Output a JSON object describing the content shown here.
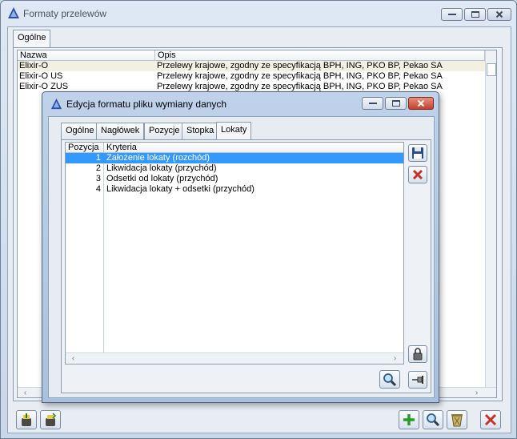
{
  "window": {
    "title": "Formaty przelewów",
    "tab": "Ogólne",
    "columns": [
      "Nazwa",
      "Opis"
    ],
    "rows": [
      {
        "name": "Elixir-O",
        "desc": "Przelewy krajowe, zgodny ze specyfikacją BPH, ING, PKO BP, Pekao SA"
      },
      {
        "name": "Elixir-O US",
        "desc": "Przelewy krajowe, zgodny ze specyfikacją BPH, ING, PKO BP, Pekao SA"
      },
      {
        "name": "Elixir-O ZUS",
        "desc": "Przelewy krajowe, zgodny ze specyfikacją BPH, ING, PKO BP, Pekao SA"
      }
    ]
  },
  "dialog": {
    "title": "Edycja formatu pliku wymiany danych",
    "tabs": [
      "Ogólne",
      "Nagłówek",
      "Pozycje",
      "Stopka",
      "Lokaty"
    ],
    "active_tab": "Lokaty",
    "columns": [
      "Pozycja",
      "Kryteria"
    ],
    "rows": [
      {
        "pos": "1",
        "crit": "Założenie lokaty (rozchód)"
      },
      {
        "pos": "2",
        "crit": "Likwidacja lokaty (przychód)"
      },
      {
        "pos": "3",
        "crit": "Odsetki od lokaty (przychód)"
      },
      {
        "pos": "4",
        "crit": "Likwidacja lokaty + odsetki (przychód)"
      }
    ]
  },
  "colors": {
    "selection": "#3399ff",
    "close_red": "#c8302a",
    "add_green": "#2a9a2a"
  },
  "icons": [
    "app-icon",
    "minimize-icon",
    "maximize-icon",
    "close-icon",
    "save-icon",
    "cancel-icon",
    "lock-icon",
    "search-icon",
    "pin-icon",
    "import-icon",
    "export-icon",
    "add-icon",
    "delete-icon",
    "exit-icon"
  ]
}
